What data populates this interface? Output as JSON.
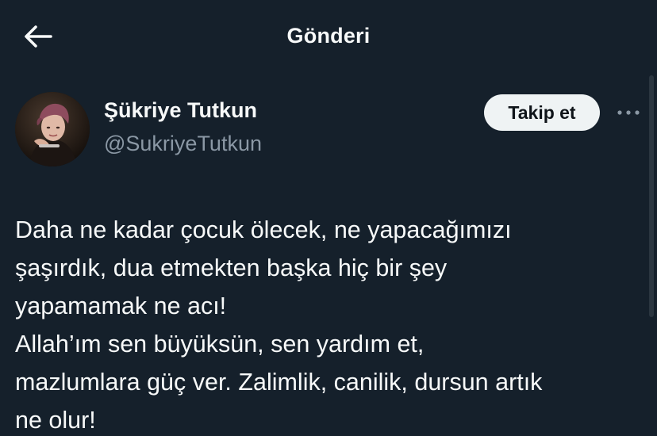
{
  "header": {
    "title": "Gönderi",
    "back_icon": "arrow-left-icon"
  },
  "author": {
    "display_name": "Şükriye Tutkun",
    "handle": "@SukriyeTutkun",
    "avatar": "profile-photo"
  },
  "actions": {
    "follow_label": "Takip et",
    "more_icon": "more-dots-icon"
  },
  "tweet": {
    "lines": [
      "Daha ne kadar çocuk ölecek, ne yapacağımızı",
      "şaşırdık, dua etmekten başka hiç bir şey",
      "yapamamak ne acı!",
      "Allah’ım sen büyüksün, sen yardım et,",
      "mazlumlara güç ver. Zalimlik, canilik, dursun artık",
      "ne olur!"
    ]
  },
  "colors": {
    "background": "#15202b",
    "text": "#f7f9f9",
    "secondary_text": "#8b98a5",
    "button_bg": "#eff3f4",
    "button_text": "#0f1419"
  }
}
